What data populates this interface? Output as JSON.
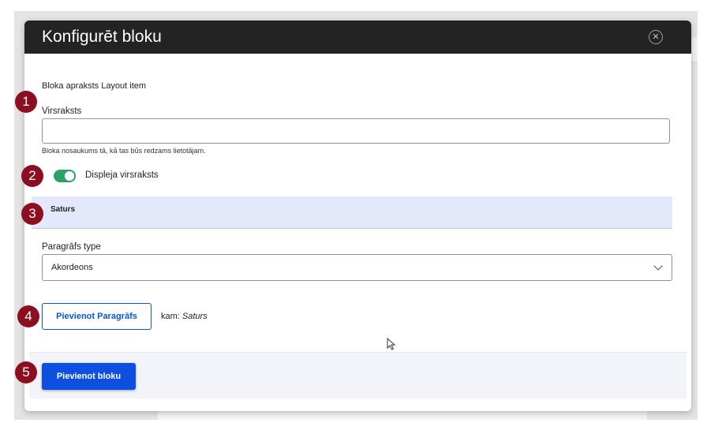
{
  "dialog": {
    "title": "Konfigurēt bloku",
    "close_icon": "close-icon"
  },
  "form": {
    "block_description": "Bloka apraksts Layout item",
    "title_field": {
      "label": "Virsraksts",
      "value": "",
      "placeholder": "",
      "hint": "Bloka nosaukums tā, kā tas būs redzams lietotājam."
    },
    "display_title_toggle": {
      "label": "Displeja virsraksts",
      "checked": true,
      "color": "#28a464"
    },
    "section": {
      "title": "Saturs",
      "background": "#e3e9fa"
    },
    "paragraph_type": {
      "label": "Paragrāfs type",
      "selected": "Akordeons"
    },
    "add_paragraph": {
      "button_label": "Pievienot Paragrāfs",
      "target_prefix": "kam:",
      "target_name": "Saturs"
    }
  },
  "footer": {
    "add_block_label": "Pievienot bloku",
    "primary_color": "#0d50e0"
  },
  "annotations": [
    "1",
    "2",
    "3",
    "4",
    "5"
  ],
  "annotation_color": "#8b0f21"
}
